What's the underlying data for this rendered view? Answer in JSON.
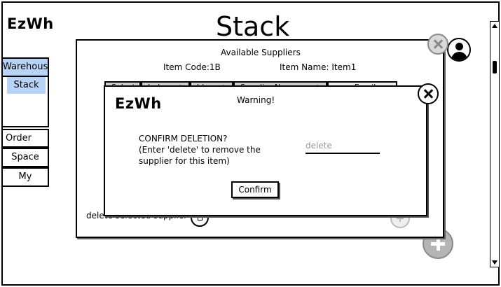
{
  "app": {
    "logo": "EzWh",
    "page_title": "Stack"
  },
  "sidebar": {
    "warehouse": "Warehous",
    "stack": "Stack",
    "order": "Order",
    "space": "Space",
    "my": "My"
  },
  "suppliers_dialog": {
    "title": "Available Suppliers",
    "item_code": "Item Code:1B",
    "item_name": "Item Name: Item1",
    "columns": [
      "Select",
      "Index",
      "Id",
      "Supplier Name",
      "Email"
    ],
    "delete_label": "delete selected supplier"
  },
  "warning_dialog": {
    "logo": "EzWh",
    "title": "Warning!",
    "message": "CONFIRM DELETION?\n(Enter 'delete' to remove the supplier for this item)",
    "input_placeholder": "delete",
    "confirm_label": "Confirm"
  },
  "icons": {
    "avatar": "user-avatar-icon",
    "close": "close-icon",
    "trash": "trash-icon",
    "add": "plus-icon"
  },
  "colors": {
    "selected": "#b8d3f5",
    "header_gray": "#cccccc"
  }
}
